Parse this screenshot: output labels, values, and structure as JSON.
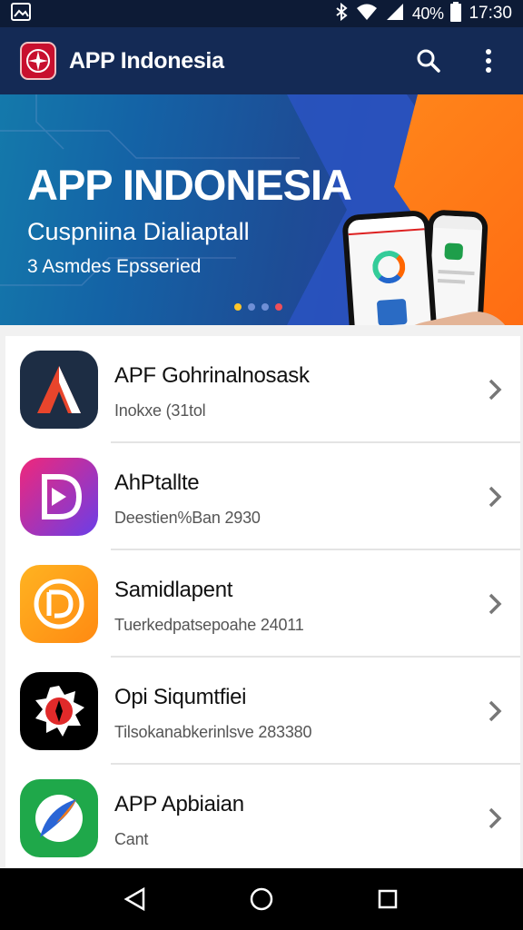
{
  "status": {
    "battery_pct": "40%",
    "time": "17:30"
  },
  "app_bar": {
    "title": "APP Indonesia",
    "icons": [
      "logo-icon",
      "search-icon",
      "more-vert-icon"
    ]
  },
  "banner": {
    "title": "APP INDONESIA",
    "subtitle": "Cuspniina Dialiaptall",
    "caption": "3 Asmdes Epsseried",
    "slide_count": 4,
    "active_slide": 1
  },
  "apps": [
    {
      "name": "APF Gohrinalnosask",
      "meta": "Inokxe (31tol",
      "icon": "a-letter-icon",
      "color": "#1d2d44"
    },
    {
      "name": "AhPtallte",
      "meta": "Deestien%Ban 2930",
      "icon": "d-play-icon",
      "color": "#e2338a"
    },
    {
      "name": "Samidlapent",
      "meta": "Tuerkedpatsepoahe 24011",
      "icon": "dp-badge-icon",
      "color": "#ff9f1a"
    },
    {
      "name": "Opi Siqumtfiei",
      "meta": "Tilsokanabkerinlsve 283380",
      "icon": "compass-badge-icon",
      "color": "#000000"
    },
    {
      "name": "APP Apbiaian",
      "meta": "Cant",
      "icon": "leaf-compass-icon",
      "color": "#1fa84a"
    }
  ],
  "nav": {
    "icons": [
      "back-icon",
      "home-icon",
      "recents-icon"
    ]
  },
  "colors": {
    "app_bar": "#142a55",
    "accent_orange": "#ff7a14",
    "status_bar": "#0d1b36"
  }
}
